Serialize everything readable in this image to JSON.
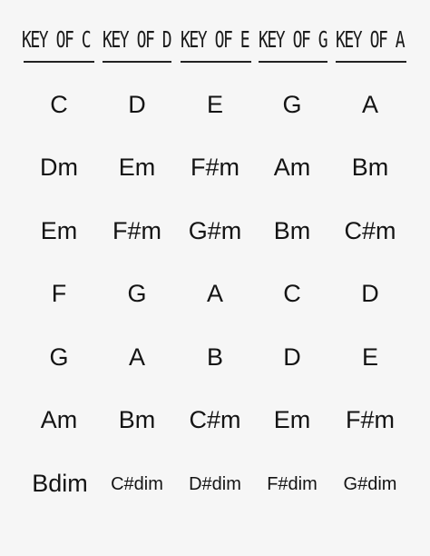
{
  "headers": [
    "KEY OF C",
    "KEY OF D",
    "KEY OF E",
    "KEY OF G",
    "KEY OF A"
  ],
  "rows": [
    [
      "C",
      "D",
      "E",
      "G",
      "A"
    ],
    [
      "Dm",
      "Em",
      "F#m",
      "Am",
      "Bm"
    ],
    [
      "Em",
      "F#m",
      "G#m",
      "Bm",
      "C#m"
    ],
    [
      "F",
      "G",
      "A",
      "C",
      "D"
    ],
    [
      "G",
      "A",
      "B",
      "D",
      "E"
    ],
    [
      "Am",
      "Bm",
      "C#m",
      "Em",
      "F#m"
    ],
    [
      "Bdim",
      "C#dim",
      "D#dim",
      "F#dim",
      "G#dim"
    ]
  ]
}
